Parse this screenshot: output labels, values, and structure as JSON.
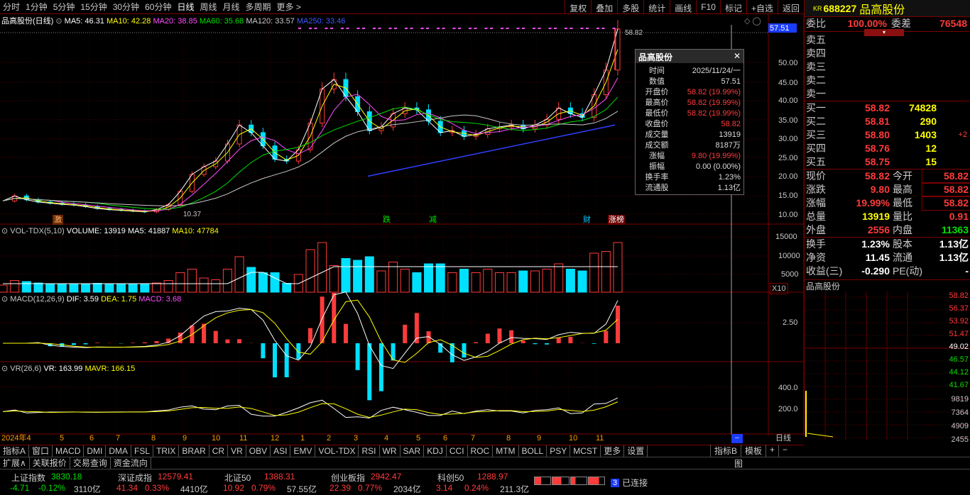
{
  "toolbar": {
    "periods": [
      "分时",
      "1分钟",
      "5分钟",
      "15分钟",
      "30分钟",
      "60分钟",
      "日线",
      "周线",
      "月线",
      "多周期",
      "更多 >"
    ],
    "active": "日线",
    "actions": [
      "复权",
      "叠加",
      "多股",
      "统计",
      "画线",
      "F10",
      "标记",
      "+自选",
      "返回"
    ]
  },
  "header": {
    "title": "品高股份(日线)",
    "ma5": "MA5: 46.31",
    "ma10": "MA10: 42.28",
    "ma20": "MA20: 38.85",
    "ma60": "MA60: 35.68",
    "ma120": "MA120: 33.57",
    "ma250": "MA250: 33.46"
  },
  "price_axis": {
    "ticks": [
      "50.00",
      "45.00",
      "40.00",
      "35.00",
      "30.00",
      "25.00",
      "20.00",
      "15.00",
      "10.00"
    ],
    "current": "57.51",
    "high_marker": "58.82",
    "low_marker": "10.37"
  },
  "events": [
    "激",
    "跌",
    "减",
    "财",
    "涨榜"
  ],
  "volume": {
    "title": "VOL-TDX(5,10)",
    "vol": "VOLUME: 13919",
    "ma5": "MA5: 41887",
    "ma10": "MA10: 47784",
    "ticks": [
      "15000",
      "10000",
      "5000"
    ],
    "unit": "X10"
  },
  "macd": {
    "title": "MACD(12,26,9)",
    "dif": "DIF: 3.59",
    "dea": "DEA: 1.75",
    "macd": "MACD: 3.68",
    "ticks": [
      "2.50"
    ]
  },
  "vr": {
    "title": "VR(26,6)",
    "vr": "VR: 163.99",
    "mavr": "MAVR: 166.15",
    "ticks": [
      "400.0",
      "200.0"
    ]
  },
  "xaxis": {
    "labels": [
      "2024年4",
      "5",
      "6",
      "7",
      "8",
      "9",
      "10",
      "11",
      "12",
      "1",
      "2",
      "3",
      "4",
      "5",
      "6",
      "7",
      "8",
      "9",
      "10",
      "11"
    ],
    "period": "日线"
  },
  "tooltip": {
    "title": "品高股份",
    "rows": [
      {
        "k": "时间",
        "v": "2025/11/24/一"
      },
      {
        "k": "数值",
        "v": "57.51"
      },
      {
        "k": "开盘价",
        "v": "58.82 (19.99%)"
      },
      {
        "k": "最高价",
        "v": "58.82 (19.99%)"
      },
      {
        "k": "最低价",
        "v": "58.82 (19.99%)"
      },
      {
        "k": "收盘价",
        "v": "58.82"
      },
      {
        "k": "成交量",
        "v": "13919"
      },
      {
        "k": "成交额",
        "v": "8187万"
      },
      {
        "k": "涨幅",
        "v": "9.80 (19.99%)"
      },
      {
        "k": "振幅",
        "v": "0.00 (0.00%)"
      },
      {
        "k": "换手率",
        "v": "1.23%"
      },
      {
        "k": "流通股",
        "v": "1.13亿"
      }
    ]
  },
  "quote": {
    "tag": "KR",
    "code": "688227",
    "name": "品高股份",
    "weibi_label": "委比",
    "weibi": "100.00%",
    "weicha_label": "委差",
    "weicha": "76548",
    "sells": [
      "卖五",
      "卖四",
      "卖三",
      "卖二",
      "卖一"
    ],
    "buys": [
      {
        "l": "买一",
        "p": "58.82",
        "v": "74828",
        "c": ""
      },
      {
        "l": "买二",
        "p": "58.81",
        "v": "290",
        "c": ""
      },
      {
        "l": "买三",
        "p": "58.80",
        "v": "1403",
        "c": "+2"
      },
      {
        "l": "买四",
        "p": "58.76",
        "v": "12",
        "c": ""
      },
      {
        "l": "买五",
        "p": "58.75",
        "v": "15",
        "c": ""
      }
    ],
    "stats": [
      {
        "a": "现价",
        "b": "58.82",
        "c": "今开",
        "d": "58.82"
      },
      {
        "a": "涨跌",
        "b": "9.80",
        "c": "最高",
        "d": "58.82"
      },
      {
        "a": "涨幅",
        "b": "19.99%",
        "c": "最低",
        "d": "58.82"
      },
      {
        "a": "总量",
        "b": "13919",
        "c": "量比",
        "d": "0.91"
      },
      {
        "a": "外盘",
        "b": "2556",
        "c": "内盘",
        "d": "11363"
      }
    ],
    "stats2": [
      {
        "a": "换手",
        "b": "1.23%",
        "c": "股本",
        "d": "1.13亿"
      },
      {
        "a": "净资",
        "b": "11.45",
        "c": "流通",
        "d": "1.13亿"
      },
      {
        "a": "收益(三)",
        "b": "-0.290",
        "c": "PE(动)",
        "d": "-"
      }
    ],
    "mini_title": "品高股份",
    "mini_prices": [
      "58.82",
      "56.37",
      "53.92",
      "51.47",
      "49.02",
      "46.57",
      "44.12",
      "41.67"
    ],
    "mini_vols": [
      "9819",
      "7364",
      "4909",
      "2455"
    ]
  },
  "tabs": [
    "指标A",
    "窗口",
    "MACD",
    "DMI",
    "DMA",
    "FSL",
    "TRIX",
    "BRAR",
    "CR",
    "VR",
    "OBV",
    "ASI",
    "EMV",
    "VOL-TDX",
    "RSI",
    "WR",
    "SAR",
    "KDJ",
    "CCI",
    "ROC",
    "MTM",
    "BOLL",
    "PSY",
    "MCST",
    "更多",
    "设置"
  ],
  "tabs_right": [
    "指标B",
    "模板",
    "+",
    "−"
  ],
  "tabs2": [
    "扩展∧",
    "关联报价",
    "交易查询",
    "资金流向"
  ],
  "tabs2_right": "图",
  "indices": [
    {
      "n": "上证指数",
      "v": "3830.18",
      "d": "-4.71",
      "p": "-0.12%",
      "a": "3110亿",
      "up": false
    },
    {
      "n": "深证成指",
      "v": "12579.41",
      "d": "41.34",
      "p": "0.33%",
      "a": "4410亿",
      "up": true
    },
    {
      "n": "北证50",
      "v": "1388.31",
      "d": "10.92",
      "p": "0.79%",
      "a": "57.55亿",
      "up": true
    },
    {
      "n": "创业板指",
      "v": "2942.47",
      "d": "22.39",
      "p": "0.77%",
      "a": "2034亿",
      "up": true
    },
    {
      "n": "科创50",
      "v": "1288.97",
      "d": "3.14",
      "p": "0.24%",
      "a": "211.3亿",
      "up": true
    }
  ],
  "connection": {
    "num": "3",
    "text": "已连接"
  },
  "colors": {
    "up": "#ff3b3b",
    "down": "#00e0ff",
    "ma5": "#ffffff",
    "ma10": "#ffff00",
    "ma20": "#ff4dff",
    "ma60": "#00e000",
    "ma120": "#c8c8c8",
    "ma250": "#3040ff",
    "grid": "#7a0000"
  },
  "chart_data": {
    "type": "line",
    "title": "品高股份(日线)",
    "x": [
      "2024年4",
      "5",
      "6",
      "7",
      "8",
      "9",
      "10",
      "11",
      "12",
      "1",
      "2",
      "3",
      "4",
      "5",
      "6",
      "7",
      "8",
      "9",
      "10",
      "11"
    ],
    "close": [
      13.5,
      14.8,
      13.8,
      13.2,
      12.9,
      12.6,
      12.4,
      12.0,
      11.5,
      11.2,
      11.0,
      10.8,
      10.6,
      11.2,
      12.5,
      16.0,
      20.5,
      22.5,
      24.0,
      28.5,
      33.5,
      31.5,
      28.0,
      24.5,
      24.0,
      27.0,
      34.0,
      43.0,
      45.5,
      41.0,
      37.0,
      32.0,
      33.0,
      36.5,
      38.0,
      37.5,
      34.5,
      31.5,
      32.0,
      30.5,
      31.0,
      32.5,
      33.0,
      33.5,
      32.5,
      33.5,
      35.0,
      38.0,
      36.5,
      35.5,
      41.5,
      48.0,
      58.82
    ],
    "ylim": [
      8,
      60
    ]
  }
}
